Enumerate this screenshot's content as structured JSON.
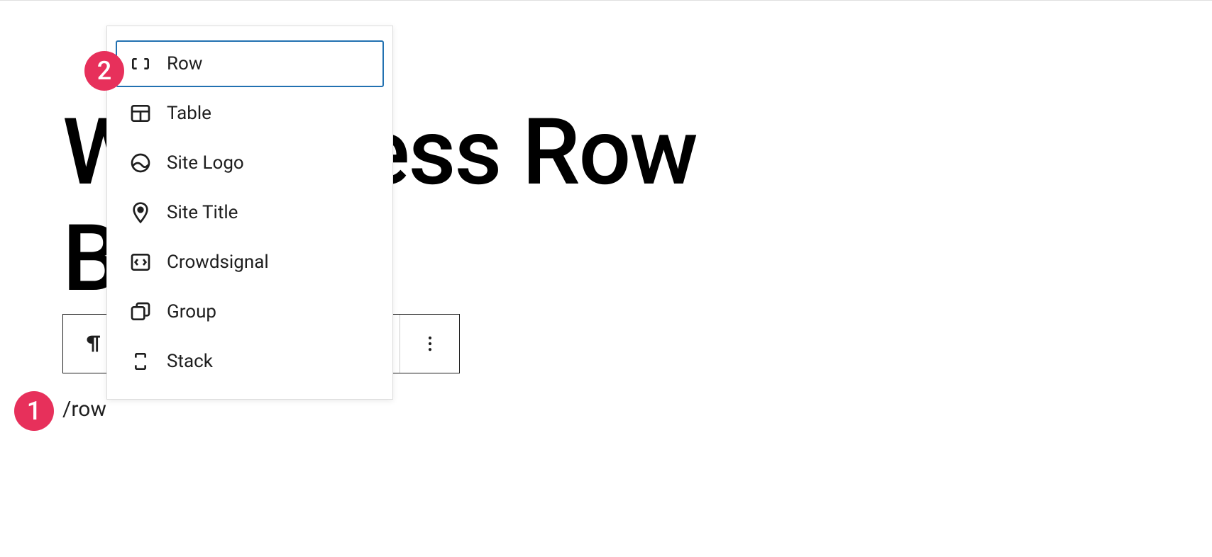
{
  "post": {
    "title_line1": "WordPress Row",
    "title_line2": "Block"
  },
  "slash_command": "/row",
  "popover": {
    "items": [
      {
        "label": "Row",
        "icon": "row-icon",
        "selected": true
      },
      {
        "label": "Table",
        "icon": "table-icon",
        "selected": false
      },
      {
        "label": "Site Logo",
        "icon": "site-logo-icon",
        "selected": false
      },
      {
        "label": "Site Title",
        "icon": "site-title-icon",
        "selected": false
      },
      {
        "label": "Crowdsignal",
        "icon": "crowdsignal-icon",
        "selected": false
      },
      {
        "label": "Group",
        "icon": "group-icon",
        "selected": false
      },
      {
        "label": "Stack",
        "icon": "stack-icon",
        "selected": false
      }
    ]
  },
  "annotations": {
    "badge1": "1",
    "badge2": "2"
  }
}
